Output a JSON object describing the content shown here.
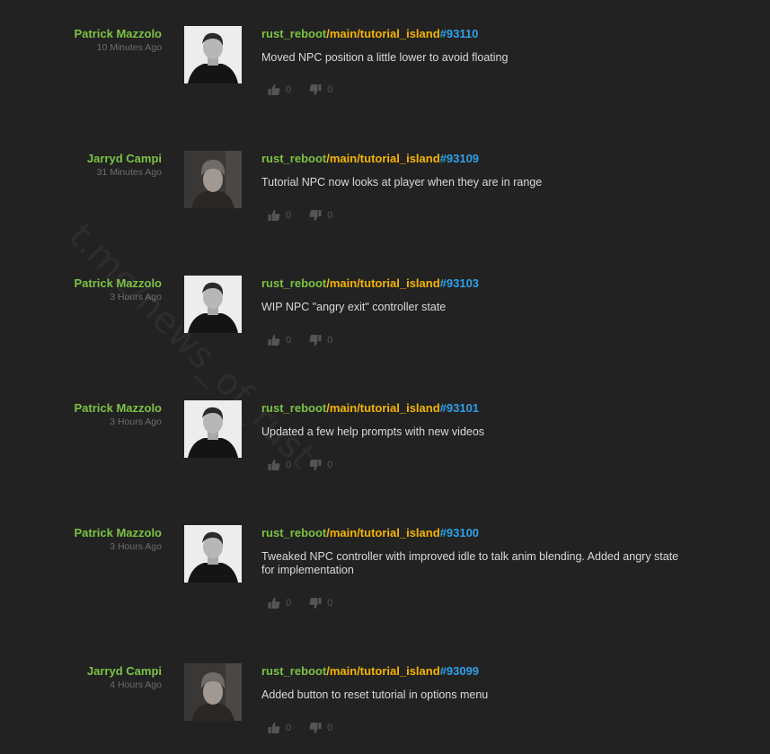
{
  "commits": [
    {
      "author": "Patrick Mazzolo",
      "time": "10 Minutes Ago",
      "avatar_icon": "patrick-avatar",
      "repo": "rust_reboot",
      "path": "/main/tutorial_island",
      "id": "#93110",
      "message": "Moved NPC position a little lower to avoid floating",
      "likes": "0",
      "dislikes": "0"
    },
    {
      "author": "Jarryd Campi",
      "time": "31 Minutes Ago",
      "avatar_icon": "jarryd-avatar",
      "repo": "rust_reboot",
      "path": "/main/tutorial_island",
      "id": "#93109",
      "message": "Tutorial NPC now looks at player when they are in range",
      "likes": "0",
      "dislikes": "0"
    },
    {
      "author": "Patrick Mazzolo",
      "time": "3 Hours Ago",
      "avatar_icon": "patrick-avatar",
      "repo": "rust_reboot",
      "path": "/main/tutorial_island",
      "id": "#93103",
      "message": "WIP NPC \"angry exit\" controller state",
      "likes": "0",
      "dislikes": "0"
    },
    {
      "author": "Patrick Mazzolo",
      "time": "3 Hours Ago",
      "avatar_icon": "patrick-avatar",
      "repo": "rust_reboot",
      "path": "/main/tutorial_island",
      "id": "#93101",
      "message": "Updated a few help prompts with new videos",
      "likes": "0",
      "dislikes": "0"
    },
    {
      "author": "Patrick Mazzolo",
      "time": "3 Hours Ago",
      "avatar_icon": "patrick-avatar",
      "repo": "rust_reboot",
      "path": "/main/tutorial_island",
      "id": "#93100",
      "message": "Tweaked NPC controller with improved idle to talk anim blending. Added angry state for implementation",
      "likes": "0",
      "dislikes": "0"
    },
    {
      "author": "Jarryd Campi",
      "time": "4 Hours Ago",
      "avatar_icon": "jarryd-avatar",
      "repo": "rust_reboot",
      "path": "/main/tutorial_island",
      "id": "#93099",
      "message": "Added button to reset tutorial in options menu",
      "likes": "0",
      "dislikes": "0"
    }
  ],
  "watermark": "t.me/news_of_rust",
  "colors": {
    "background": "#222222",
    "author": "#7cc243",
    "repo": "#7cc243",
    "path": "#f5b400",
    "commit_id": "#2ea0e8",
    "message": "#d9d9d9",
    "muted": "#6d6d6d"
  }
}
